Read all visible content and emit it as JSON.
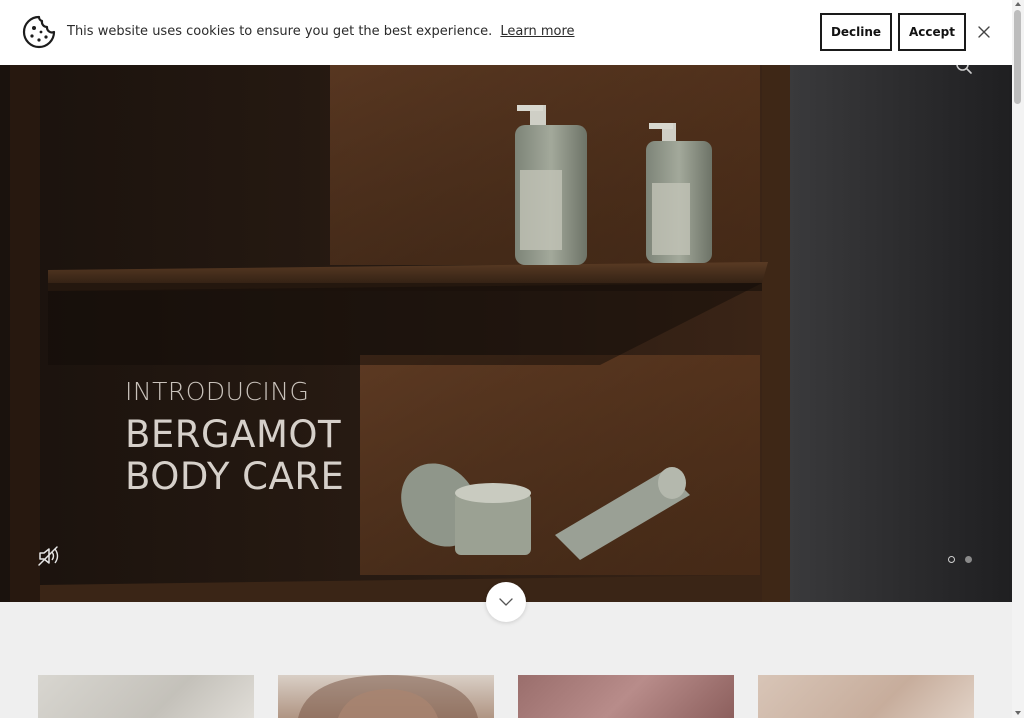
{
  "cookie_banner": {
    "message": "This website uses cookies to ensure you get the best experience.",
    "learn_more": "Learn more",
    "decline_label": "Decline",
    "accept_label": "Accept",
    "icons": [
      "cookie-icon",
      "close-icon"
    ]
  },
  "hero": {
    "eyebrow": "INTRODUCING",
    "title_line1": "BERGAMOT",
    "title_line2": "BODY CARE",
    "slides_total": 2,
    "active_slide": 1,
    "icons": [
      "search-icon",
      "mute-icon",
      "chevron-down-icon"
    ]
  },
  "colors": {
    "banner_bg": "#ffffff",
    "button_border": "#1a1a1a",
    "page_bg": "#efefef",
    "hero_text": "#d6d0ca"
  }
}
